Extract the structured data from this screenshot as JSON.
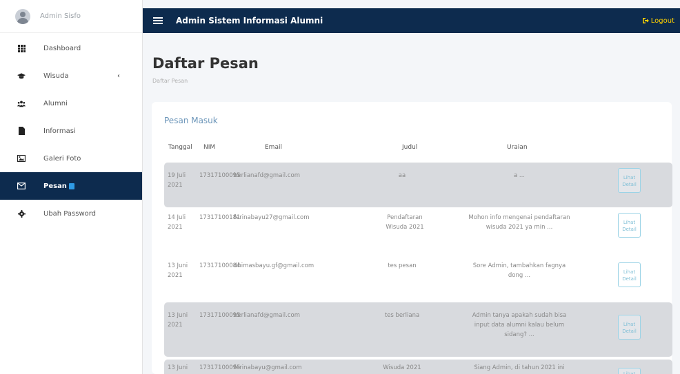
{
  "sidebar": {
    "brand": "Admin Sisfo",
    "items": [
      {
        "label": "Dashboard",
        "icon": "grid-icon"
      },
      {
        "label": "Wisuda",
        "icon": "graduation-cap-icon",
        "chevron": "‹"
      },
      {
        "label": "Alumni",
        "icon": "users-icon"
      },
      {
        "label": "Informasi",
        "icon": "file-icon"
      },
      {
        "label": "Galeri Foto",
        "icon": "image-icon"
      },
      {
        "label": "Pesan",
        "icon": "envelope-icon",
        "active": true
      },
      {
        "label": "Ubah Password",
        "icon": "gear-icon"
      }
    ]
  },
  "topbar": {
    "title": "Admin Sistem Informasi Alumni",
    "logout": "Logout"
  },
  "page": {
    "title": "Daftar Pesan",
    "breadcrumb": "Daftar Pesan"
  },
  "card": {
    "title": "Pesan Masuk",
    "headers": {
      "tanggal": "Tanggal",
      "nim": "NIM",
      "email": "Email",
      "judul": "Judul",
      "uraian": "Uraian"
    },
    "button_line1": "Lihat",
    "button_line2": "Detail",
    "rows": [
      {
        "tanggal": "19 Juli 2021",
        "nim": "17317100095",
        "email": "berlianafd@gmail.com",
        "judul": "aa",
        "uraian": "a ..."
      },
      {
        "tanggal": "14 Juli 2021",
        "nim": "17317100181",
        "email": "ferinabayu27@gmail.com",
        "judul": "Pendaftaran Wisuda 2021",
        "uraian": "Mohon info mengenai pendaftaran wisuda 2021 ya min ..."
      },
      {
        "tanggal": "13 Juni 2021",
        "nim": "17317100084",
        "email": "dhimasbayu.gf@gmail.com",
        "judul": "tes pesan",
        "uraian": "Sore Admin, tambahkan fagnya dong ..."
      },
      {
        "tanggal": "13 Juni 2021",
        "nim": "17317100095",
        "email": "berlianafd@gmail.com",
        "judul": "tes berliana",
        "uraian": "Admin tanya apakah sudah bisa input data alumni kalau belum sidang? ..."
      },
      {
        "tanggal": "13 Juni",
        "nim": "17317100095",
        "email": "ferinabayu@gmail.com",
        "judul": "Wisuda 2021",
        "uraian": "Siang Admin, di tahun 2021 ini"
      }
    ]
  },
  "colors": {
    "navy": "#0d2b4e",
    "logout": "#ffd200",
    "card_title": "#6b95b9",
    "row_shade": "#d8dade",
    "badge": "#2f9be5"
  }
}
